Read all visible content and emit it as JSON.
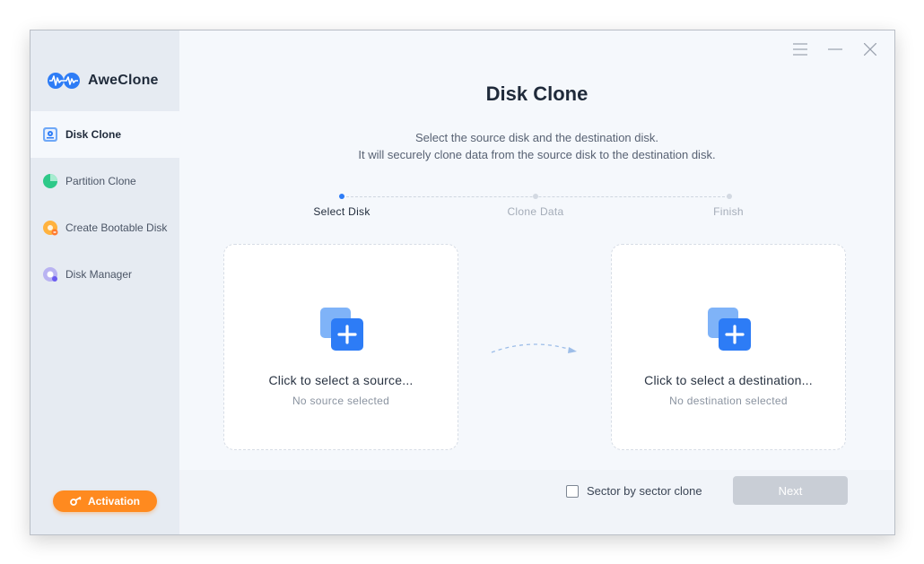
{
  "app": {
    "name": "AweClone"
  },
  "sidebar": {
    "items": [
      {
        "label": "Disk Clone",
        "icon": "disk-clone-icon",
        "active": true
      },
      {
        "label": "Partition Clone",
        "icon": "partition-clone-icon",
        "active": false
      },
      {
        "label": "Create Bootable Disk",
        "icon": "bootable-disk-icon",
        "active": false
      },
      {
        "label": "Disk Manager",
        "icon": "disk-manager-icon",
        "active": false
      }
    ],
    "activation_label": "Activation"
  },
  "window_controls": {
    "menu_icon": "hamburger-menu-icon",
    "minimize_icon": "minimize-icon",
    "close_icon": "close-icon"
  },
  "main": {
    "title": "Disk Clone",
    "subtitle_line1": "Select the source disk and the destination disk.",
    "subtitle_line2": "It will securely clone data from the source disk to the destination disk.",
    "steps": [
      {
        "label": "Select Disk",
        "active": true
      },
      {
        "label": "Clone Data",
        "active": false
      },
      {
        "label": "Finish",
        "active": false
      }
    ],
    "source_card": {
      "title": "Click to select a source...",
      "status": "No source selected"
    },
    "destination_card": {
      "title": "Click to select a destination...",
      "status": "No destination selected"
    },
    "sector_by_sector_label": "Sector by sector clone",
    "sector_by_sector_checked": false,
    "next_label": "Next"
  },
  "colors": {
    "accent_blue": "#2d7cf6",
    "activation_orange": "#ff8a1f",
    "disabled_button": "#c9ced6"
  }
}
